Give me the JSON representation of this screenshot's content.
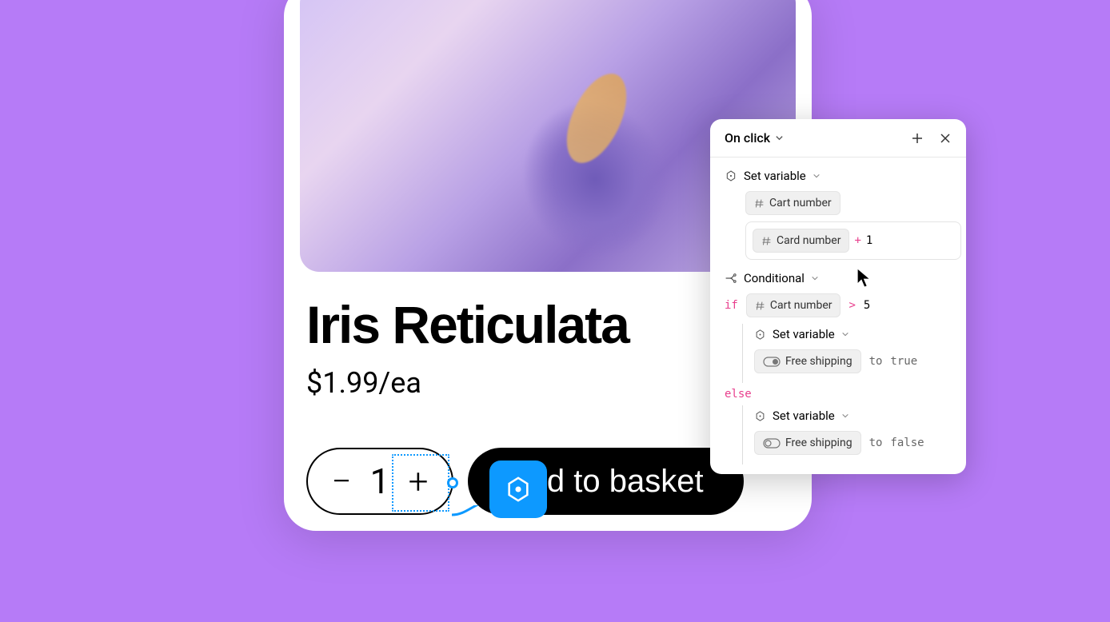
{
  "product": {
    "title": "Iris Reticulata",
    "price": "$1.99/ea",
    "quantity": "1",
    "add_button": "Add to basket"
  },
  "panel": {
    "trigger": "On click",
    "action1": {
      "type": "Set variable",
      "target_var": "Cart number",
      "expr_var": "Card number",
      "expr_op": "+",
      "expr_val": "1"
    },
    "action2": {
      "type": "Conditional",
      "if_kw": "if",
      "if_var": "Cart number",
      "if_op": ">",
      "if_val": "5",
      "then_action": "Set variable",
      "then_var": "Free shipping",
      "then_to": "to",
      "then_val": "true",
      "else_kw": "else",
      "else_action": "Set variable",
      "else_var": "Free shipping",
      "else_to": "to",
      "else_val": "false"
    }
  }
}
